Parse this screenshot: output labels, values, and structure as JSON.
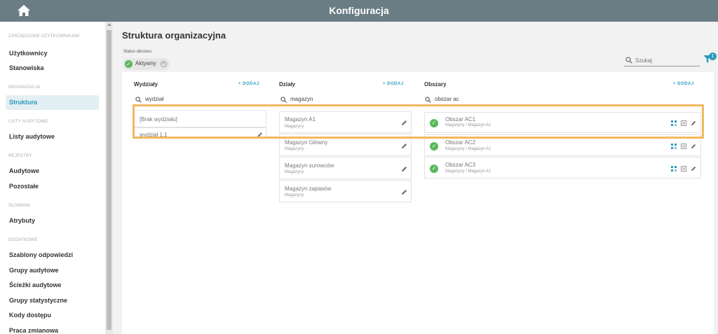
{
  "header": {
    "title": "Konfiguracja"
  },
  "sidebar": {
    "sections": [
      {
        "label": "ZARZĄDZANIE UŻYTKOWNIKAMI",
        "items": [
          {
            "label": "Użytkownicy"
          },
          {
            "label": "Stanowiska"
          }
        ]
      },
      {
        "label": "ORGANIZACJA",
        "items": [
          {
            "label": "Struktura",
            "active": true
          }
        ]
      },
      {
        "label": "LISTY AUDYTOWE",
        "items": [
          {
            "label": "Listy audytowe"
          }
        ]
      },
      {
        "label": "REJESTRY",
        "items": [
          {
            "label": "Audytowe"
          },
          {
            "label": "Pozostałe"
          }
        ]
      },
      {
        "label": "SŁOWNIKI",
        "items": [
          {
            "label": "Atrybuty"
          }
        ]
      },
      {
        "label": "DODATKOWE",
        "items": [
          {
            "label": "Szablony odpowiedzi"
          },
          {
            "label": "Grupy audytowe"
          },
          {
            "label": "Ścieżki audytowe"
          },
          {
            "label": "Grupy statystyczne"
          },
          {
            "label": "Kody dostępu"
          },
          {
            "label": "Praca zmianowa"
          }
        ]
      }
    ]
  },
  "main": {
    "title": "Struktura organizacyjna",
    "status_filter": {
      "label": "Status obszaru",
      "chip": "Aktywny"
    },
    "search": {
      "placeholder": "Szukaj"
    },
    "filter_badge": "1",
    "columns": {
      "wydzialy": {
        "title": "Wydziały",
        "add_label": "DODAJ",
        "search_value": "wydział",
        "items": [
          {
            "title": "[Brak wydziału]"
          },
          {
            "title": "wydział 1.1"
          }
        ]
      },
      "dzialy": {
        "title": "Działy",
        "add_label": "DODAJ",
        "search_value": "magazyn",
        "items": [
          {
            "title": "Magazyn A1",
            "subtitle": "Magazyny"
          },
          {
            "title": "Magazyn Główny",
            "subtitle": "Magazyny"
          },
          {
            "title": "Magazyn surowców",
            "subtitle": "Magazyny"
          },
          {
            "title": "Magazyn zapasów",
            "subtitle": "Magazyny"
          }
        ]
      },
      "obszary": {
        "title": "Obszary",
        "add_label": "DODAJ",
        "search_value": "obszar ac",
        "items": [
          {
            "title": "Obszar AC1",
            "subtitle": "Magazyny / Magazyn A1"
          },
          {
            "title": "Obszar AC2",
            "subtitle": "Magazyny / Magazyn A1"
          },
          {
            "title": "Obszar AC3",
            "subtitle": "Magazyny / Magazyn A1"
          }
        ]
      }
    }
  },
  "colors": {
    "header": "#6b7d84",
    "accent": "#2b9bbf",
    "success": "#5cb85c",
    "highlight": "#f3b860"
  }
}
